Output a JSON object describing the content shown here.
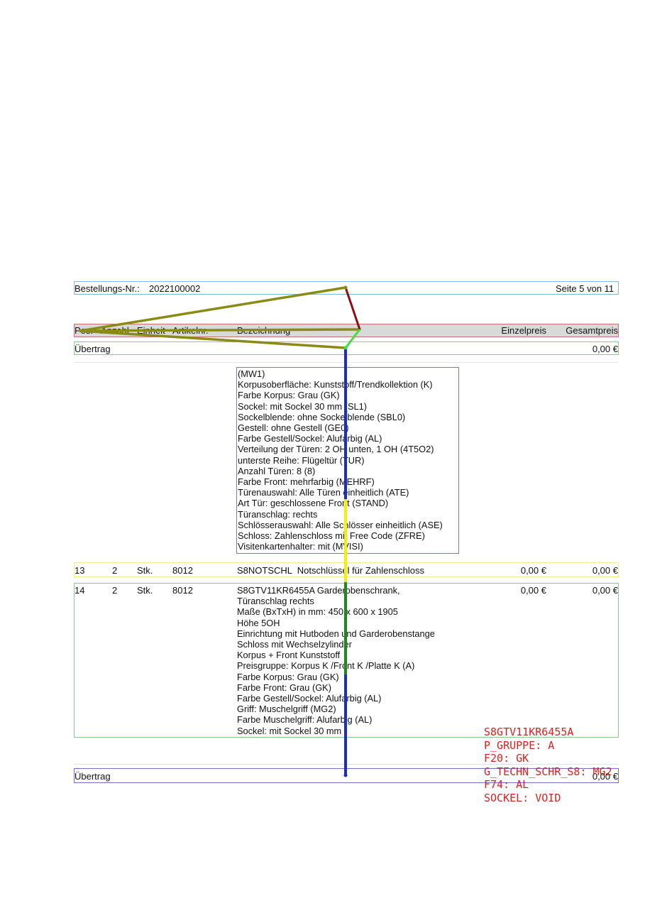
{
  "header": {
    "order_label": "Bestellungs-Nr.:",
    "order_number": "2022100002",
    "page_info": "Seite 5 von 11"
  },
  "columns": {
    "pos": "Pos.",
    "anzahl": "Anzahl",
    "einheit": "Einheit",
    "artikelnr": "Artikelnr.",
    "bezeichnung": "Bezeichnung",
    "einzelpreis": "Einzelpreis",
    "gesamtpreis": "Gesamtpreis"
  },
  "carry_top": {
    "label": "Übertrag",
    "amount": "0,00 €"
  },
  "config_block": [
    "(MW1)",
    "Korpusoberfläche: Kunststoff/Trendkollektion (K)",
    "Farbe Korpus: Grau (GK)",
    "Sockel: mit Sockel 30 mm (SL1)",
    "Sockelblende: ohne Sockelblende (SBL0)",
    "Gestell: ohne Gestell (GE0)",
    "Farbe Gestell/Sockel: Alufarbig (AL)",
    "Verteilung der Türen: 2 OH unten, 1 OH (4T5O2)",
    "unterste Reihe: Flügeltür (TUR)",
    "Anzahl Türen: 8 (8)",
    "Farbe Front: mehrfarbig (MEHRF)",
    "Türenauswahl: Alle Türen einheitlich (ATE)",
    "Art Tür: geschlossene Front (STAND)",
    "Türanschlag: rechts",
    "Schlösserauswahl: Alle Schlösser einheitlich (ASE)",
    "Schloss: Zahlenschloss mit Free Code (ZFRE)",
    "Visitenkartenhalter: mit (MVISI)"
  ],
  "row13": {
    "pos": "13",
    "anzahl": "2",
    "einheit": "Stk.",
    "artikelnr": "8012",
    "bezeichnung": "S8NOTSCHL  Notschlüssel für Zahlenschloss",
    "einzelpreis": "0,00 €",
    "gesamtpreis": "0,00 €"
  },
  "row14": {
    "pos": "14",
    "anzahl": "2",
    "einheit": "Stk.",
    "artikelnr": "8012",
    "einzelpreis": "0,00 €",
    "gesamtpreis": "0,00 €",
    "lines": [
      "S8GTV11KR6455A Garderobenschrank,",
      "Türanschlag rechts",
      "Maße (BxTxH) in mm: 450 x 600 x 1905",
      "Höhe 5OH",
      "Einrichtung mit Hutboden und Garderobenstange",
      "Schloss mit Wechselzylinder",
      "Korpus + Front Kunststoff",
      "Preisgruppe: Korpus K /Front K /Platte K (A)",
      "Farbe Korpus: Grau (GK)",
      "Farbe Front: Grau (GK)",
      "Farbe Gestell/Sockel: Alufarbig (AL)",
      "Griff: Muschelgriff (MG2)",
      "Farbe Muschelgriff: Alufarbig (AL)",
      "Sockel: mit Sockel 30 mm"
    ]
  },
  "carry_bottom": {
    "label": "Übertrag",
    "amount": "0,00 €"
  },
  "red_note": [
    "S8GTV11KR6455A",
    "P_GRUPPE: A",
    "F20: GK",
    "G_TECHN_SCHR_S8: MG2",
    "F74: AL",
    "SOCKEL: VOID"
  ],
  "colors": {
    "header_bg": "#d9d9d9",
    "order_box": "#7fb9d6",
    "header_border": "#c86e6e",
    "carry_border": "#7ed47e",
    "row13_border": "#f3ec8a",
    "row14_border": "#8bc98b",
    "config_border": "#7a7ab8",
    "bottom_border": "#6f6fd0",
    "red_note": "#e0201a",
    "olive_line": "#8a8a14",
    "darkred_line": "#8b1010",
    "bright_green_line": "#3ee03e",
    "blue_line": "#1a2bd0",
    "yellow_line": "#f5f000",
    "green_line": "#1a8a1a"
  }
}
